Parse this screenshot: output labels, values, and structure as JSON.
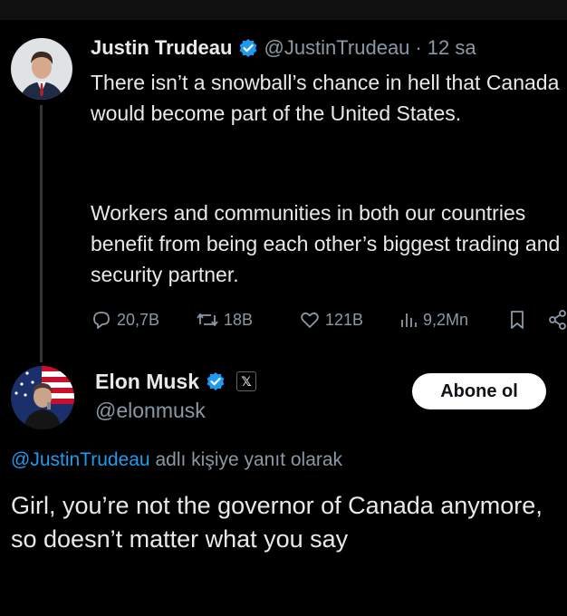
{
  "tweet1": {
    "author_name": "Justin Trudeau",
    "handle": "@JustinTrudeau",
    "separator": "·",
    "time": "12 sa",
    "paragraph1": "There isn’t a snowball’s chance in hell that Canada would become part of the United States.",
    "paragraph2": "Workers and communities in both our countries benefit from being each other’s biggest trading and security partner.",
    "stats": {
      "replies": "20,7B",
      "reposts": "18B",
      "likes": "121B",
      "views": "9,2Mn"
    }
  },
  "tweet2": {
    "author_name": "Elon Musk",
    "x_badge": "𝕏",
    "handle": "@elonmusk",
    "follow_label": "Abone ol",
    "reply_mention": "@JustinTrudeau",
    "reply_suffix": " adlı kişiye yanıt olarak",
    "text": "Girl, you’re not the governor of Canada anymore, so doesn’t matter what you say"
  },
  "colors": {
    "background": "#000000",
    "text": "#e7e9ea",
    "muted": "#8b98a5",
    "link": "#1d9bf0",
    "verified": "#1d9bf0",
    "follow_button_bg": "#ffffff"
  },
  "icons": [
    "verified-badge-icon",
    "reply-icon",
    "repost-icon",
    "like-icon",
    "views-icon",
    "bookmark-icon",
    "share-icon"
  ]
}
